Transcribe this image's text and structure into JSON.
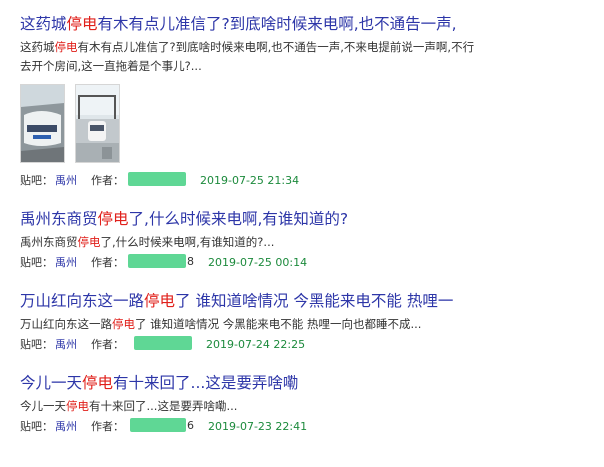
{
  "posts": [
    {
      "title_pre": "这药城",
      "title_hl": "停电",
      "title_post": "有木有点儿准信了?到底啥时候来电啊,也不通告一声,",
      "abstract_line1_pre": "这药城",
      "abstract_line1_hl": "停电",
      "abstract_line1_post": "有木有点儿准信了?到底啥时候来电啊,也不通告一声,不来电提前说一声啊,不行",
      "abstract_line2": "去开个房间,这一直拖着是个事儿?...",
      "forum_label": "贴吧：",
      "forum": "禹州",
      "author_label": "作者：",
      "author_visible": "",
      "time": "2019-07-25 21:34"
    },
    {
      "title_pre": "禹州东商贸",
      "title_hl": "停电",
      "title_post": "了,什么时候来电啊,有谁知道的?",
      "abstract_pre": "禹州东商贸",
      "abstract_hl": "停电",
      "abstract_post": "了,什么时候来电啊,有谁知道的?...",
      "forum_label": "贴吧：",
      "forum": "禹州",
      "author_label": "作者：",
      "author_visible": "8",
      "time": "2019-07-25 00:14"
    },
    {
      "title_pre": "万山红向东这一路",
      "title_hl": "停电",
      "title_post": "了 谁知道啥情况 今黑能来电不能 热哩一",
      "abstract_pre": "万山红向东这一路",
      "abstract_hl": "停电",
      "abstract_post": "了 谁知道啥情况 今黑能来电不能 热哩一向也都睡不成...",
      "forum_label": "贴吧：",
      "forum": "禹州",
      "author_label": "作者：",
      "author_visible": "",
      "time": "2019-07-24 22:25"
    },
    {
      "title_pre": "今儿一天",
      "title_hl": "停电",
      "title_post": "有十来回了...这是要弄啥嘞",
      "abstract_pre": "今儿一天",
      "abstract_hl": "停电",
      "abstract_post": "有十来回了...这是要弄啥嘞...",
      "forum_label": "贴吧：",
      "forum": "禹州",
      "author_label": "作者：",
      "author_visible": "6",
      "time": "2019-07-23 22:41"
    }
  ],
  "colors": {
    "title": "#2d36a8",
    "highlight": "#e0201b",
    "time": "#1c8a3c",
    "mask": "#5fd795"
  }
}
